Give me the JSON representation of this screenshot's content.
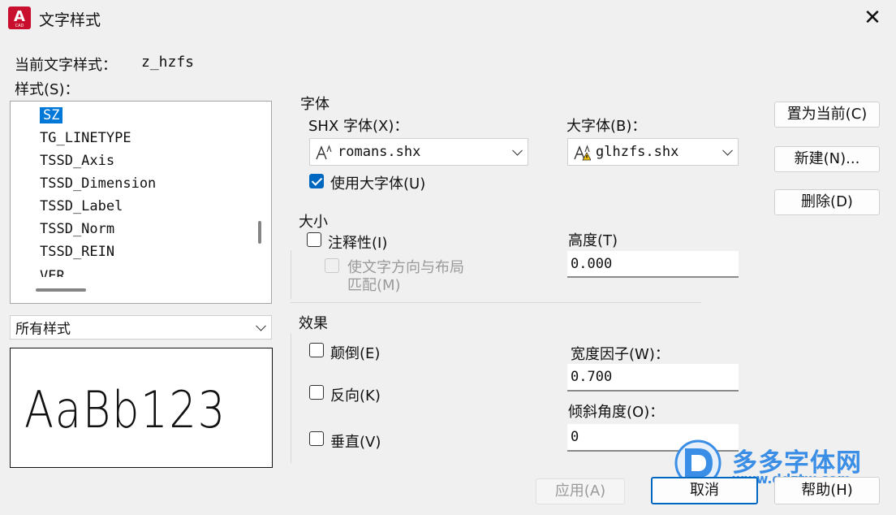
{
  "window": {
    "title": "文字样式",
    "close": "✕"
  },
  "current_style": {
    "label": "当前文字样式：",
    "value": "z_hzfs"
  },
  "styles": {
    "label": "样式(S)：",
    "items": [
      "SZ",
      "TG_LINETYPE",
      "TSSD_Axis",
      "TSSD_Dimension",
      "TSSD_Label",
      "TSSD_Norm",
      "TSSD_REIN",
      "VER"
    ],
    "selected": "SZ",
    "filter": "所有样式"
  },
  "preview": {
    "text": "AaBb123"
  },
  "font": {
    "section": "字体",
    "shx_label": "SHX 字体(X)：",
    "shx_value": "romans.shx",
    "big_label": "大字体(B)：",
    "big_value": "glhzfs.shx",
    "use_big_label": "使用大字体(U)",
    "use_big_checked": true
  },
  "size": {
    "section": "大小",
    "annotative_label": "注释性(I)",
    "match_label_1": "使文字方向与布局",
    "match_label_2": "匹配(M)",
    "height_label": "高度(T)",
    "height_value": "0.000"
  },
  "effects": {
    "section": "效果",
    "upside_down": "颠倒(E)",
    "backwards": "反向(K)",
    "vertical": "垂直(V)",
    "width_label": "宽度因子(W)：",
    "width_value": "0.700",
    "oblique_label": "倾斜角度(O)：",
    "oblique_value": "0"
  },
  "buttons": {
    "set_current": "置为当前(C)",
    "new": "新建(N)...",
    "delete": "删除(D)",
    "apply": "应用(A)",
    "cancel": "取消",
    "help": "帮助(H)"
  },
  "watermark": {
    "name": "多多字体网",
    "url": "www.ddztw.com"
  },
  "colors": {
    "accent": "#0067c0",
    "selection": "#0078d7",
    "app_red": "#c8102e",
    "watermark": "#3a8ee6"
  }
}
